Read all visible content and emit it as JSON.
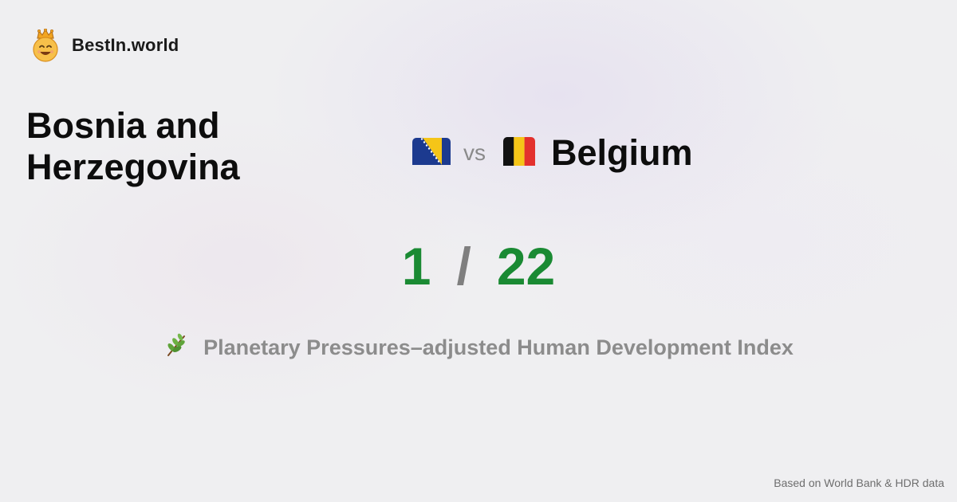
{
  "brand": {
    "name": "BestIn.world",
    "logo_icon": "crowned-smiley-icon"
  },
  "comparison": {
    "left_country": "Bosnia and Herzegovina",
    "left_flag_icon": "bosnia-flag-icon",
    "vs_label": "vs",
    "right_flag_icon": "belgium-flag-icon",
    "right_country": "Belgium"
  },
  "scores": {
    "left": "1",
    "separator": "/",
    "right": "22",
    "color": "#1a8a33"
  },
  "metric": {
    "icon": "herb-icon",
    "label": "Planetary Pressures–adjusted Human Development Index"
  },
  "footer": {
    "source": "Based on World Bank & HDR data"
  }
}
